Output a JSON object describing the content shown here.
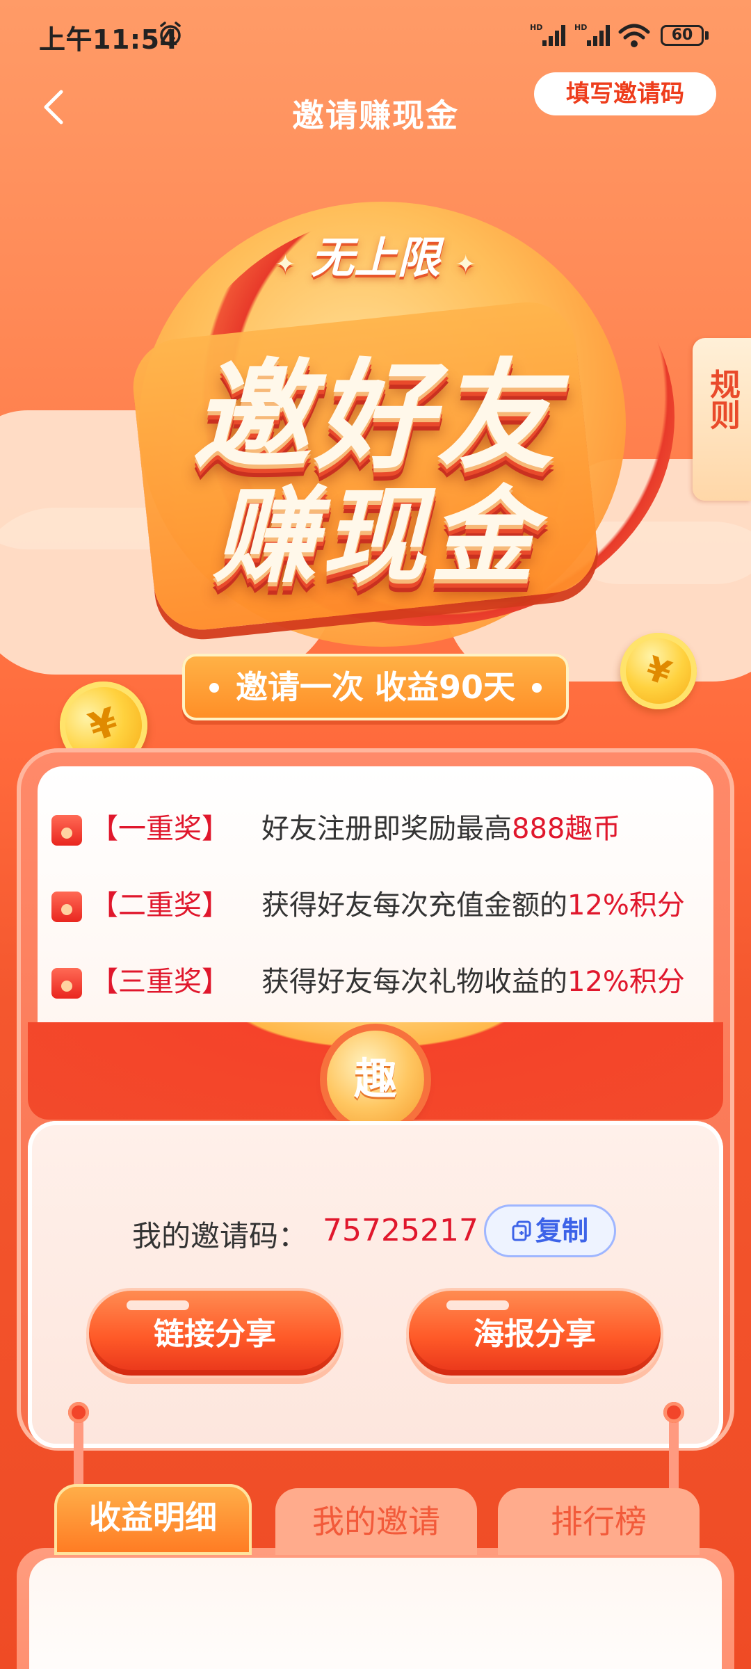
{
  "status_bar": {
    "time": "上午11:54",
    "battery": "60"
  },
  "header": {
    "title": "邀请赚现金",
    "fill_code_label": "填写邀请码"
  },
  "hero": {
    "badge": "无上限",
    "line1": "邀好友",
    "line2": "赚现金",
    "tagline": "邀请一次 收益90天",
    "rules_label": "规则",
    "coin_symbol": "¥"
  },
  "rewards": [
    {
      "tier": "【一重奖】",
      "text": "好友注册即奖励最高",
      "highlight": "888趣币"
    },
    {
      "tier": "【二重奖】",
      "text": "获得好友每次充值金额的",
      "highlight": "12%积分"
    },
    {
      "tier": "【三重奖】",
      "text": "获得好友每次礼物收益的",
      "highlight": "12%积分"
    }
  ],
  "emblem": "趣",
  "invite": {
    "label": "我的邀请码：",
    "code": "75725217",
    "copy_label": "复制",
    "share_link_label": "链接分享",
    "share_poster_label": "海报分享"
  },
  "tabs": [
    {
      "label": "收益明细",
      "active": true
    },
    {
      "label": "我的邀请",
      "active": false
    },
    {
      "label": "排行榜",
      "active": false
    }
  ],
  "colors": {
    "accent_red": "#e0172c",
    "brand_orange": "#ff7a48",
    "copy_blue": "#3d63e8"
  }
}
